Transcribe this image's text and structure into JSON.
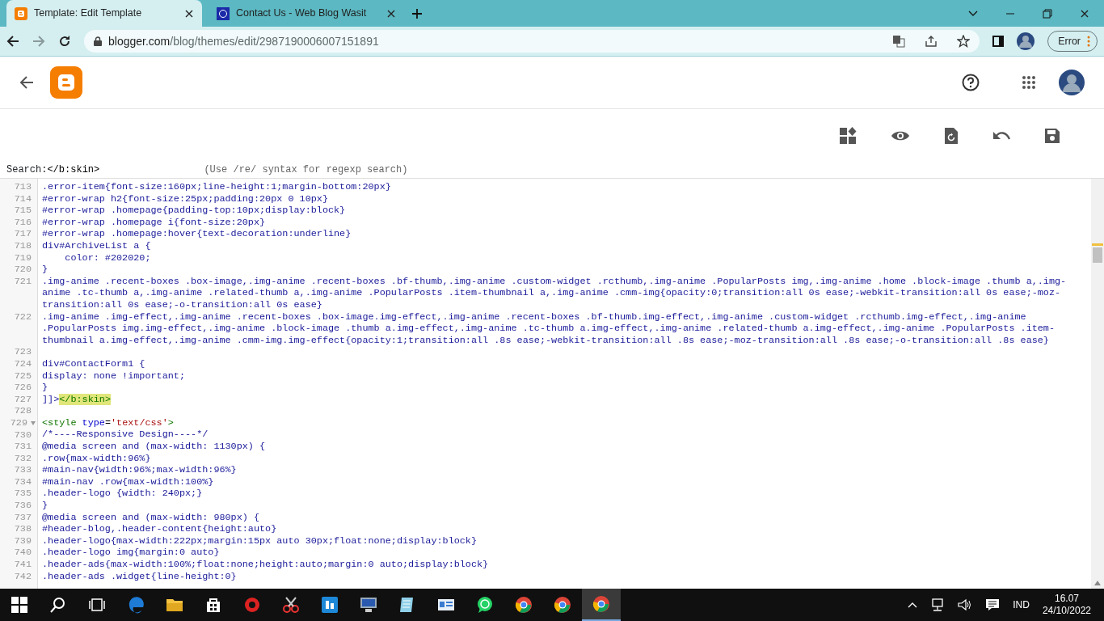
{
  "browser": {
    "tabs": [
      {
        "title": "Template: Edit Template",
        "selected": true,
        "kind": "blogger"
      },
      {
        "title": "Contact Us - Web Blog Wasit",
        "selected": false,
        "kind": "site"
      }
    ],
    "forward_disabled": true,
    "address_host": "blogger.com",
    "address_path": "/blog/themes/edit/2987190006007151891",
    "profile_label": "Error"
  },
  "search": {
    "label": "Search:",
    "value": "</b:skin>",
    "hint": "(Use /re/ syntax for regexp search)"
  },
  "lines": [
    {
      "number": "713",
      "rows": [
        ".error-item{font-size:160px;line-height:1;margin-bottom:20px}"
      ]
    },
    {
      "number": "714",
      "rows": [
        "#error-wrap h2{font-size:25px;padding:20px 0 10px}"
      ]
    },
    {
      "number": "715",
      "rows": [
        "#error-wrap .homepage{padding-top:10px;display:block}"
      ]
    },
    {
      "number": "716",
      "rows": [
        "#error-wrap .homepage i{font-size:20px}"
      ]
    },
    {
      "number": "717",
      "rows": [
        "#error-wrap .homepage:hover{text-decoration:underline}"
      ]
    },
    {
      "number": "718",
      "rows": [
        "div#ArchiveList a {"
      ]
    },
    {
      "number": "719",
      "rows": [
        "    color: #202020;"
      ]
    },
    {
      "number": "720",
      "rows": [
        "}"
      ]
    },
    {
      "number": "721",
      "rows": [
        ".img-anime .recent-boxes .box-image,.img-anime .recent-boxes .bf-thumb,.img-anime .custom-widget .rcthumb,.img-anime .PopularPosts img,.img-anime .home .block-image .thumb a,.img-",
        "anime .tc-thumb a,.img-anime .related-thumb a,.img-anime .PopularPosts .item-thumbnail a,.img-anime .cmm-img{opacity:0;transition:all 0s ease;-webkit-transition:all 0s ease;-moz-",
        "transition:all 0s ease;-o-transition:all 0s ease}"
      ]
    },
    {
      "number": "722",
      "rows": [
        ".img-anime .img-effect,.img-anime .recent-boxes .box-image.img-effect,.img-anime .recent-boxes .bf-thumb.img-effect,.img-anime .custom-widget .rcthumb.img-effect,.img-anime",
        ".PopularPosts img.img-effect,.img-anime .block-image .thumb a.img-effect,.img-anime .tc-thumb a.img-effect,.img-anime .related-thumb a.img-effect,.img-anime .PopularPosts .item-",
        "thumbnail a.img-effect,.img-anime .cmm-img.img-effect{opacity:1;transition:all .8s ease;-webkit-transition:all .8s ease;-moz-transition:all .8s ease;-o-transition:all .8s ease}"
      ]
    },
    {
      "number": "723",
      "rows": [
        ""
      ]
    },
    {
      "number": "724",
      "rows": [
        "div#ContactForm1 {"
      ]
    },
    {
      "number": "725",
      "rows": [
        "display: none !important;"
      ]
    },
    {
      "number": "726",
      "rows": [
        "}"
      ]
    },
    {
      "number": "727",
      "tokens": [
        {
          "text": "]]>",
          "kind": "plain",
          "highlighted": false
        },
        {
          "text": "</b:skin>",
          "kind": "tag",
          "highlighted": true
        }
      ]
    },
    {
      "number": "728",
      "rows": [
        ""
      ]
    },
    {
      "number": "729",
      "foldable": true,
      "tokens": [
        {
          "text": "<style",
          "kind": "tag",
          "highlighted": false
        },
        {
          "text": " type",
          "kind": "attribute",
          "highlighted": false
        },
        {
          "text": "=",
          "kind": "operator",
          "highlighted": false
        },
        {
          "text": "'text/css'",
          "kind": "string",
          "highlighted": false
        },
        {
          "text": ">",
          "kind": "tag",
          "highlighted": false
        }
      ]
    },
    {
      "number": "730",
      "rows": [
        "/*----Responsive Design----*/"
      ]
    },
    {
      "number": "731",
      "rows": [
        "@media screen and (max-width: 1130px) {"
      ]
    },
    {
      "number": "732",
      "rows": [
        ".row{max-width:96%}"
      ]
    },
    {
      "number": "733",
      "rows": [
        "#main-nav{width:96%;max-width:96%}"
      ]
    },
    {
      "number": "734",
      "rows": [
        "#main-nav .row{max-width:100%}"
      ]
    },
    {
      "number": "735",
      "rows": [
        ".header-logo {width: 240px;}"
      ]
    },
    {
      "number": "736",
      "rows": [
        "}"
      ]
    },
    {
      "number": "737",
      "rows": [
        "@media screen and (max-width: 980px) {"
      ]
    },
    {
      "number": "738",
      "rows": [
        "#header-blog,.header-content{height:auto}"
      ]
    },
    {
      "number": "739",
      "rows": [
        ".header-logo{max-width:222px;margin:15px auto 30px;float:none;display:block}"
      ]
    },
    {
      "number": "740",
      "rows": [
        ".header-logo img{margin:0 auto}"
      ]
    },
    {
      "number": "741",
      "rows": [
        ".header-ads{max-width:100%;float:none;height:auto;margin:0 auto;display:block}"
      ]
    },
    {
      "number": "742",
      "rows": [
        ".header-ads .widget{line-height:0}"
      ]
    }
  ],
  "taskbar": {
    "apps": [
      {
        "kind": "edge",
        "selected": false
      },
      {
        "kind": "folder",
        "selected": false
      },
      {
        "kind": "store",
        "selected": false
      },
      {
        "kind": "redgear",
        "selected": false
      },
      {
        "kind": "scissors",
        "selected": false
      },
      {
        "kind": "fs",
        "selected": false
      },
      {
        "kind": "monitor",
        "selected": false
      },
      {
        "kind": "notepad",
        "selected": false
      },
      {
        "kind": "card",
        "selected": false
      },
      {
        "kind": "whatsapp",
        "selected": false
      },
      {
        "kind": "chrome",
        "selected": false
      },
      {
        "kind": "chrome",
        "selected": false
      },
      {
        "kind": "chrome",
        "selected": true
      }
    ],
    "language": "IND",
    "time": "16.07",
    "date": "24/10/2022"
  }
}
